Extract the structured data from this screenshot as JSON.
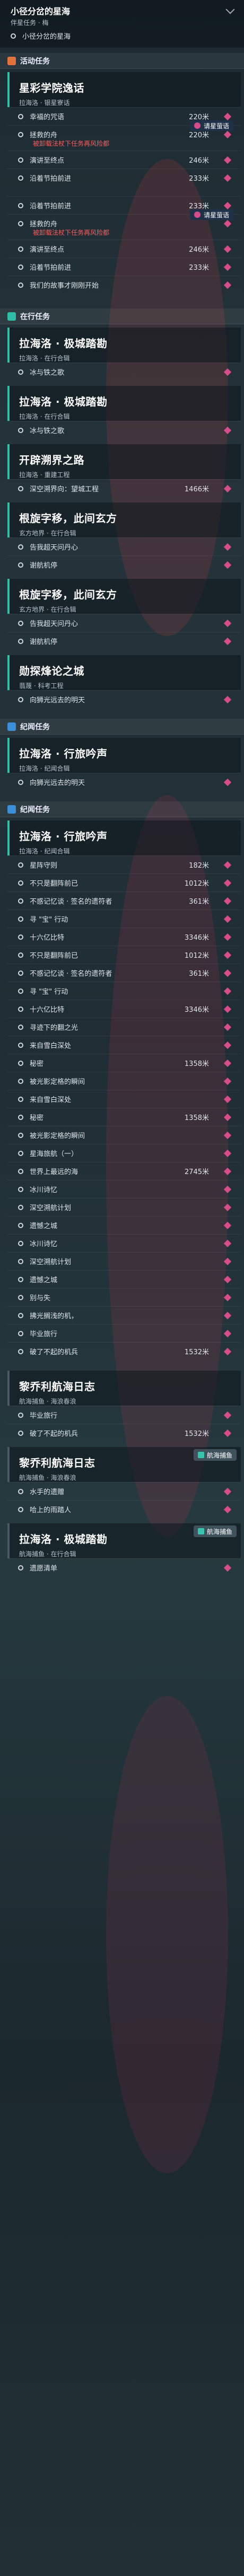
{
  "top": {
    "title": "小径分岔的星海",
    "subtitle": "伴星任务 · 梅",
    "step": "小径分岔的星海"
  },
  "activity": {
    "label": "活动任务"
  },
  "quests": [
    {
      "title": "星彩学院逸话",
      "sub": "拉海洛 · 银星寮话",
      "steps": [
        {
          "label": "幸福的咒语",
          "dist": "220米"
        },
        {
          "label": "拯救的舟",
          "dist": "220米",
          "warn": "被卸载法杖下任务再风险都",
          "req": "请星萤语"
        },
        {
          "label": "演讲至终点",
          "dist": "246米"
        },
        {
          "label": "沿着节拍前进",
          "dist": "233米"
        }
      ]
    },
    {
      "title": "",
      "sub": "",
      "steps": [
        {
          "label": "沿着节拍前进",
          "dist": "233米"
        },
        {
          "label": "拯救的舟",
          "dist": "",
          "warn": "被卸载法杖下任务再风险都",
          "req": "请星萤语"
        },
        {
          "label": "演讲至终点",
          "dist": "246米"
        },
        {
          "label": "沿着节拍前进",
          "dist": "233米"
        },
        {
          "label": "我们的故事才刚刚开始",
          "dist": ""
        }
      ]
    }
  ],
  "cat_hotel": {
    "label": "在行任务"
  },
  "hotel": [
    {
      "title": "拉海洛 · 极城踏勘",
      "sub": "拉海洛 · 在行合辑",
      "steps": [
        {
          "label": "冰与铁之歌",
          "dist": ""
        }
      ]
    },
    {
      "title": "拉海洛 · 极城踏勘",
      "sub": "拉海洛 · 在行合辑",
      "steps": [
        {
          "label": "冰与铁之歌",
          "dist": ""
        }
      ]
    },
    {
      "title": "开辟溯界之路",
      "sub": "拉海洛 · 重建工程",
      "steps": [
        {
          "label": "深空溯界向：望城工程",
          "dist": "1466米"
        }
      ]
    },
    {
      "title": "根旋字移，此间玄方",
      "sub": "玄方地界 · 在行合辑",
      "steps": [
        {
          "label": "告我超天问丹心",
          "dist": ""
        },
        {
          "label": "谢航机停",
          "dist": ""
        }
      ]
    },
    {
      "title": "根旋字移，此间玄方",
      "sub": "玄方地界 · 在行合辑",
      "steps": [
        {
          "label": "告我超天问丹心",
          "dist": ""
        },
        {
          "label": "谢航机停",
          "dist": ""
        }
      ]
    },
    {
      "title": "勋探烽论之城",
      "sub": "翡蔑 · 科考工程",
      "steps": [
        {
          "label": "向狮光远去的明天",
          "dist": ""
        }
      ]
    }
  ],
  "cat_chronicle": {
    "label": "纪闻任务"
  },
  "chronicle": [
    {
      "title": "拉海洛 · 行旅吟声",
      "sub": "拉海洛 · 纪闻合辑",
      "steps": [
        {
          "label": "向狮光远去的明天",
          "dist": ""
        }
      ]
    }
  ],
  "cat_chronicle2": {
    "label": "纪闻任务"
  },
  "chronicle2": [
    {
      "title": "拉海洛 · 行旅吟声",
      "sub": "拉海洛 · 纪闻合辑",
      "steps": [
        {
          "label": "星阵守则",
          "dist": "182米"
        },
        {
          "label": "不只是翻阵前已",
          "dist": "1012米"
        },
        {
          "label": "不惑记忆谈 · 签名的遗符者",
          "dist": "361米"
        },
        {
          "label": "寻 \"宝\" 行动",
          "dist": ""
        },
        {
          "label": "十六亿比特",
          "dist": "3346米"
        },
        {
          "label": "不只是翻阵前已",
          "dist": "1012米"
        },
        {
          "label": "不惑记忆谈 · 签名的遗符者",
          "dist": "361米"
        },
        {
          "label": "寻 \"宝\" 行动",
          "dist": ""
        },
        {
          "label": "十六亿比特",
          "dist": "3346米"
        },
        {
          "label": "寻迹下的翻之光",
          "dist": ""
        },
        {
          "label": "来自雪白深处",
          "dist": ""
        },
        {
          "label": "秘密",
          "dist": "1358米"
        },
        {
          "label": "被光影定格的瞬间",
          "dist": ""
        },
        {
          "label": "来自雪白深处",
          "dist": ""
        },
        {
          "label": "秘密",
          "dist": "1358米"
        },
        {
          "label": "被光影定格的瞬间",
          "dist": ""
        },
        {
          "label": "星海旅航（一）",
          "dist": ""
        },
        {
          "label": "世界上最远的海",
          "dist": "2745米"
        },
        {
          "label": "冰川诗忆",
          "dist": ""
        },
        {
          "label": "深空溯航计划",
          "dist": ""
        },
        {
          "label": "遗憾之城",
          "dist": ""
        },
        {
          "label": "冰川诗忆",
          "dist": ""
        },
        {
          "label": "深空溯航计划",
          "dist": ""
        },
        {
          "label": "遗憾之城",
          "dist": ""
        },
        {
          "label": "别与失",
          "dist": ""
        },
        {
          "label": "拂光搁浅的机，",
          "dist": ""
        },
        {
          "label": "毕业旅行",
          "dist": ""
        },
        {
          "label": "破了不起的机兵",
          "dist": "1532米"
        }
      ]
    }
  ],
  "log": [
    {
      "title": "黎乔利航海日志",
      "sub": "航海捕鱼 · 海浪春浪",
      "steps": [
        {
          "label": "毕业旅行",
          "dist": ""
        },
        {
          "label": "破了不起的机兵",
          "dist": "1532米"
        }
      ]
    },
    {
      "title": "黎乔利航海日志",
      "sub": "航海捕鱼 · 海浪春浪",
      "badge": "航海捕鱼",
      "steps": [
        {
          "label": "水手的遗赠",
          "dist": ""
        },
        {
          "label": "哈上的雨踏人",
          "dist": ""
        }
      ]
    },
    {
      "title": "拉海洛 · 极城踏勘",
      "sub": "航海捕鱼 · 在行合辑",
      "badge": "航海捕鱼",
      "steps": [
        {
          "label": "遗愿清单",
          "dist": ""
        }
      ]
    }
  ]
}
